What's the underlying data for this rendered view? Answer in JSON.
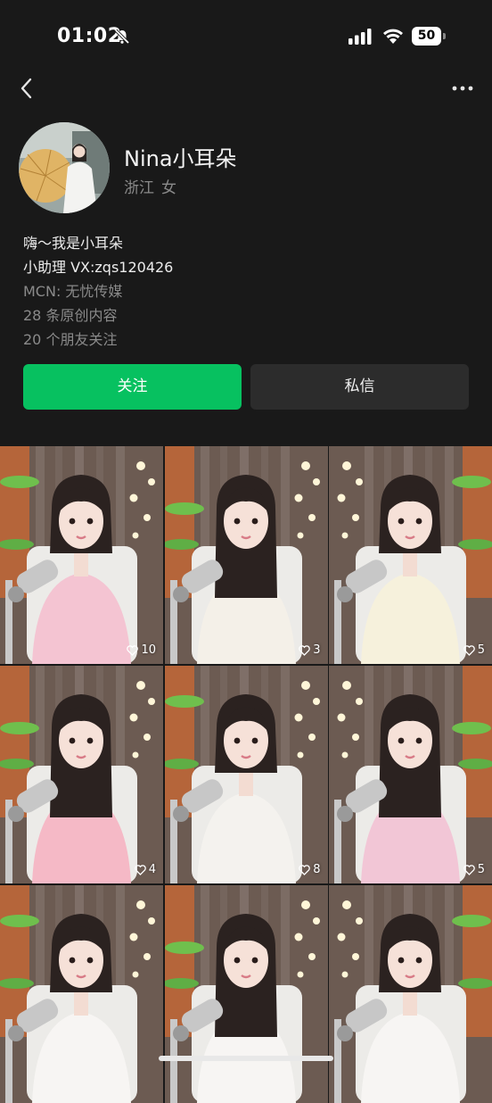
{
  "status_bar": {
    "time": "01:02",
    "battery": "50"
  },
  "profile": {
    "name": "Nina小耳朵",
    "region": "浙江",
    "gender": "女",
    "bio_lines": [
      "嗨～我是小耳朵",
      "小助理 VX:zqs120426"
    ],
    "mcn": "MCN: 无忧传媒",
    "posts_count": "28 条原创内容",
    "friends_follow": "20 个朋友关注"
  },
  "actions": {
    "follow_label": "关注",
    "message_label": "私信"
  },
  "videos": [
    {
      "likes": "10",
      "outfit": "#f4c4d2"
    },
    {
      "likes": "3",
      "outfit": "#f4f0e8"
    },
    {
      "likes": "5",
      "outfit": "#f6f1dc"
    },
    {
      "likes": "4",
      "outfit": "#f5b9c6"
    },
    {
      "likes": "8",
      "outfit": "#f4f2ee"
    },
    {
      "likes": "5",
      "outfit": "#f2c6d6"
    },
    {
      "likes": "",
      "outfit": "#f7f5f3"
    },
    {
      "likes": "",
      "outfit": "#f7f5f3"
    },
    {
      "likes": "",
      "outfit": "#f7f5f3"
    }
  ]
}
